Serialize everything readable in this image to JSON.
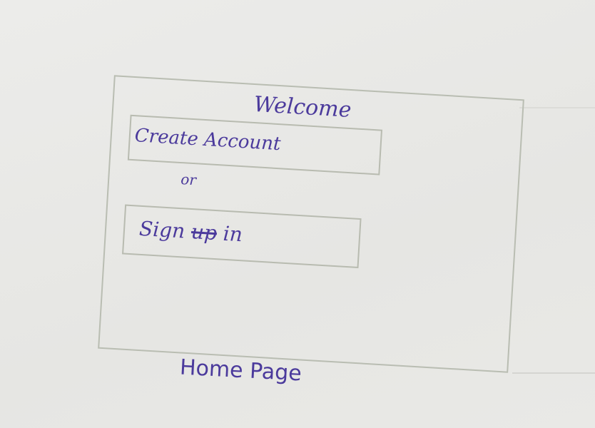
{
  "sketch": {
    "welcome": "Welcome",
    "create_account": "Create Account",
    "or": "or",
    "sign_in": {
      "word1": "Sign",
      "struck": "up",
      "word2": "in"
    },
    "caption": "Home Page",
    "ink_color": "#4b3a9c",
    "pencil_color": "#b9bdb2"
  }
}
